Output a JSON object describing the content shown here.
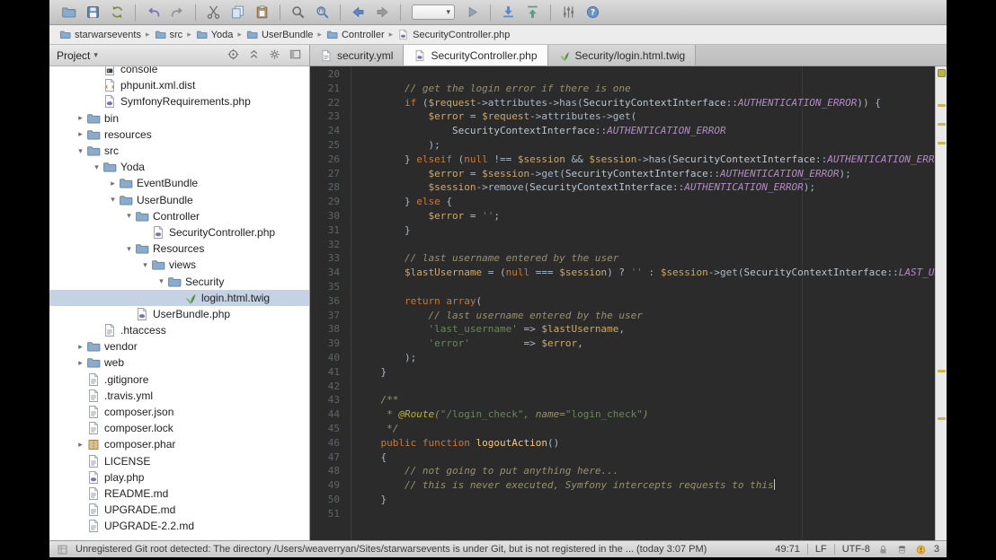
{
  "colors": {
    "editor_bg": "#2b2b2b",
    "keyword": "#cc7832",
    "string": "#6a8759",
    "comment": "#98916b",
    "constant": "#b38cc4",
    "variable": "#cda869",
    "selection": "#c4d2e3",
    "error_stripe_mark": "#c9b944"
  },
  "toolbar": {
    "groups": [
      [
        "open-folder",
        "save-all",
        "synchronize"
      ],
      [
        "undo",
        "redo"
      ],
      [
        "cut",
        "copy",
        "paste"
      ],
      [
        "find",
        "replace"
      ],
      [
        "back",
        "forward"
      ],
      [
        "run-config",
        "run"
      ],
      [
        "update-project",
        "commit"
      ],
      [
        "settings",
        "help"
      ]
    ]
  },
  "breadcrumbs": {
    "items": [
      {
        "label": "starwarsevents",
        "icon": "folder"
      },
      {
        "label": "src",
        "icon": "folder"
      },
      {
        "label": "Yoda",
        "icon": "folder"
      },
      {
        "label": "UserBundle",
        "icon": "folder"
      },
      {
        "label": "Controller",
        "icon": "folder"
      },
      {
        "label": "SecurityController.php",
        "icon": "php"
      }
    ]
  },
  "project_pane": {
    "title": "Project",
    "icons": [
      "locate",
      "collapse-all",
      "gear",
      "hide"
    ]
  },
  "tree": {
    "items": [
      {
        "label": "console",
        "level": 2,
        "icon": "console",
        "arrow": null
      },
      {
        "label": "phpunit.xml.dist",
        "level": 2,
        "icon": "xml",
        "arrow": null
      },
      {
        "label": "SymfonyRequirements.php",
        "level": 2,
        "icon": "php",
        "arrow": null
      },
      {
        "label": "bin",
        "level": 1,
        "icon": "folder",
        "arrow": "collapsed"
      },
      {
        "label": "resources",
        "level": 1,
        "icon": "folder",
        "arrow": "collapsed"
      },
      {
        "label": "src",
        "level": 1,
        "icon": "folder",
        "arrow": "expanded"
      },
      {
        "label": "Yoda",
        "level": 2,
        "icon": "folder",
        "arrow": "expanded"
      },
      {
        "label": "EventBundle",
        "level": 3,
        "icon": "folder",
        "arrow": "collapsed"
      },
      {
        "label": "UserBundle",
        "level": 3,
        "icon": "folder",
        "arrow": "expanded"
      },
      {
        "label": "Controller",
        "level": 4,
        "icon": "folder",
        "arrow": "expanded"
      },
      {
        "label": "SecurityController.php",
        "level": 5,
        "icon": "php",
        "arrow": null
      },
      {
        "label": "Resources",
        "level": 4,
        "icon": "folder",
        "arrow": "expanded"
      },
      {
        "label": "views",
        "level": 5,
        "icon": "folder",
        "arrow": "expanded"
      },
      {
        "label": "Security",
        "level": 6,
        "icon": "folder",
        "arrow": "expanded"
      },
      {
        "label": "login.html.twig",
        "level": 7,
        "icon": "twig",
        "arrow": null,
        "selected": true
      },
      {
        "label": "UserBundle.php",
        "level": 4,
        "icon": "php",
        "arrow": null
      },
      {
        "label": ".htaccess",
        "level": 2,
        "icon": "text",
        "arrow": null
      },
      {
        "label": "vendor",
        "level": 1,
        "icon": "folder",
        "arrow": "collapsed"
      },
      {
        "label": "web",
        "level": 1,
        "icon": "folder",
        "arrow": "collapsed"
      },
      {
        "label": ".gitignore",
        "level": 1,
        "icon": "text",
        "arrow": null
      },
      {
        "label": ".travis.yml",
        "level": 1,
        "icon": "text",
        "arrow": null
      },
      {
        "label": "composer.json",
        "level": 1,
        "icon": "text",
        "arrow": null
      },
      {
        "label": "composer.lock",
        "level": 1,
        "icon": "text",
        "arrow": null
      },
      {
        "label": "composer.phar",
        "level": 1,
        "icon": "archive",
        "arrow": "collapsed"
      },
      {
        "label": "LICENSE",
        "level": 1,
        "icon": "text",
        "arrow": null
      },
      {
        "label": "play.php",
        "level": 1,
        "icon": "php",
        "arrow": null
      },
      {
        "label": "README.md",
        "level": 1,
        "icon": "text",
        "arrow": null
      },
      {
        "label": "UPGRADE.md",
        "level": 1,
        "icon": "text",
        "arrow": null
      },
      {
        "label": "UPGRADE-2.2.md",
        "level": 1,
        "icon": "text",
        "arrow": null
      }
    ]
  },
  "tabs": {
    "items": [
      {
        "label": "security.yml",
        "icon": "yml",
        "active": false
      },
      {
        "label": "SecurityController.php",
        "icon": "php",
        "active": true
      },
      {
        "label": "Security/login.html.twig",
        "icon": "twig",
        "active": false
      }
    ]
  },
  "editor": {
    "caret": {
      "line": 49,
      "col": 71
    },
    "stripe_marks_percent": [
      8,
      12,
      16,
      64,
      74
    ],
    "lines": [
      {
        "n": 20,
        "t": []
      },
      {
        "n": 21,
        "t": [
          [
            "pl",
            "        "
          ],
          [
            "cmt",
            "// get the login error if there is one"
          ]
        ]
      },
      {
        "n": 22,
        "t": [
          [
            "pl",
            "        "
          ],
          [
            "kw",
            "if"
          ],
          [
            "pl",
            " ("
          ],
          [
            "var",
            "$request"
          ],
          [
            "pl",
            "->attributes->has("
          ],
          [
            "cls",
            "SecurityContextInterface"
          ],
          [
            "pl",
            "::"
          ],
          [
            "const",
            "AUTHENTICATION_ERROR"
          ],
          [
            "pl",
            ")) {"
          ]
        ]
      },
      {
        "n": 23,
        "t": [
          [
            "pl",
            "            "
          ],
          [
            "var",
            "$error"
          ],
          [
            "pl",
            " = "
          ],
          [
            "var",
            "$request"
          ],
          [
            "pl",
            "->attributes->get("
          ]
        ]
      },
      {
        "n": 24,
        "t": [
          [
            "pl",
            "                "
          ],
          [
            "cls",
            "SecurityContextInterface"
          ],
          [
            "pl",
            "::"
          ],
          [
            "const",
            "AUTHENTICATION_ERROR"
          ]
        ]
      },
      {
        "n": 25,
        "t": [
          [
            "pl",
            "            );"
          ]
        ]
      },
      {
        "n": 26,
        "t": [
          [
            "pl",
            "        } "
          ],
          [
            "kw",
            "elseif"
          ],
          [
            "pl",
            " ("
          ],
          [
            "kw",
            "null"
          ],
          [
            "pl",
            " !== "
          ],
          [
            "var",
            "$session"
          ],
          [
            "pl",
            " && "
          ],
          [
            "var",
            "$session"
          ],
          [
            "pl",
            "->has("
          ],
          [
            "cls",
            "SecurityContextInterface"
          ],
          [
            "pl",
            "::"
          ],
          [
            "const",
            "AUTHENTICATION_ERROR"
          ],
          [
            "pl",
            ")) {"
          ]
        ]
      },
      {
        "n": 27,
        "t": [
          [
            "pl",
            "            "
          ],
          [
            "var",
            "$error"
          ],
          [
            "pl",
            " = "
          ],
          [
            "var",
            "$session"
          ],
          [
            "pl",
            "->get("
          ],
          [
            "cls",
            "SecurityContextInterface"
          ],
          [
            "pl",
            "::"
          ],
          [
            "const",
            "AUTHENTICATION_ERROR"
          ],
          [
            "pl",
            ");"
          ]
        ]
      },
      {
        "n": 28,
        "t": [
          [
            "pl",
            "            "
          ],
          [
            "var",
            "$session"
          ],
          [
            "pl",
            "->remove("
          ],
          [
            "cls",
            "SecurityContextInterface"
          ],
          [
            "pl",
            "::"
          ],
          [
            "const",
            "AUTHENTICATION_ERROR"
          ],
          [
            "pl",
            ");"
          ]
        ]
      },
      {
        "n": 29,
        "t": [
          [
            "pl",
            "        } "
          ],
          [
            "kw",
            "else"
          ],
          [
            "pl",
            " {"
          ]
        ]
      },
      {
        "n": 30,
        "t": [
          [
            "pl",
            "            "
          ],
          [
            "var",
            "$error"
          ],
          [
            "pl",
            " = "
          ],
          [
            "str",
            "''"
          ],
          [
            "pl",
            ";"
          ]
        ]
      },
      {
        "n": 31,
        "t": [
          [
            "pl",
            "        }"
          ]
        ]
      },
      {
        "n": 32,
        "t": []
      },
      {
        "n": 33,
        "t": [
          [
            "pl",
            "        "
          ],
          [
            "cmt",
            "// last username entered by the user"
          ]
        ]
      },
      {
        "n": 34,
        "t": [
          [
            "pl",
            "        "
          ],
          [
            "var",
            "$lastUsername"
          ],
          [
            "pl",
            " = ("
          ],
          [
            "kw",
            "null"
          ],
          [
            "pl",
            " === "
          ],
          [
            "var",
            "$session"
          ],
          [
            "pl",
            ") ? "
          ],
          [
            "str",
            "''"
          ],
          [
            "pl",
            " : "
          ],
          [
            "var",
            "$session"
          ],
          [
            "pl",
            "->get("
          ],
          [
            "cls",
            "SecurityContextInterface"
          ],
          [
            "pl",
            "::"
          ],
          [
            "const",
            "LAST_USERNAME"
          ],
          [
            "pl",
            ");"
          ]
        ]
      },
      {
        "n": 35,
        "t": []
      },
      {
        "n": 36,
        "t": [
          [
            "pl",
            "        "
          ],
          [
            "kw",
            "return"
          ],
          [
            "pl",
            " "
          ],
          [
            "kw",
            "array"
          ],
          [
            "pl",
            "("
          ]
        ]
      },
      {
        "n": 37,
        "t": [
          [
            "pl",
            "            "
          ],
          [
            "cmt",
            "// last username entered by the user"
          ]
        ]
      },
      {
        "n": 38,
        "t": [
          [
            "pl",
            "            "
          ],
          [
            "str",
            "'last_username'"
          ],
          [
            "pl",
            " => "
          ],
          [
            "var",
            "$lastUsername"
          ],
          [
            "pl",
            ","
          ]
        ]
      },
      {
        "n": 39,
        "t": [
          [
            "pl",
            "            "
          ],
          [
            "str",
            "'error'"
          ],
          [
            "pl",
            "         => "
          ],
          [
            "var",
            "$error"
          ],
          [
            "pl",
            ","
          ]
        ]
      },
      {
        "n": 40,
        "t": [
          [
            "pl",
            "        );"
          ]
        ]
      },
      {
        "n": 41,
        "t": [
          [
            "pl",
            "    }"
          ]
        ]
      },
      {
        "n": 42,
        "t": []
      },
      {
        "n": 43,
        "t": [
          [
            "pl",
            "    "
          ],
          [
            "doc",
            "/**"
          ]
        ]
      },
      {
        "n": 44,
        "t": [
          [
            "pl",
            "     "
          ],
          [
            "doc",
            "* "
          ],
          [
            "ann",
            "@Route"
          ],
          [
            "doc",
            "("
          ],
          [
            "str",
            "\"/login_check\""
          ],
          [
            "doc",
            ", name="
          ],
          [
            "str",
            "\"login_check\""
          ],
          [
            "doc",
            ")"
          ]
        ]
      },
      {
        "n": 45,
        "t": [
          [
            "pl",
            "     "
          ],
          [
            "doc",
            "*/"
          ]
        ]
      },
      {
        "n": 46,
        "t": [
          [
            "pl",
            "    "
          ],
          [
            "kw",
            "public function"
          ],
          [
            "pl",
            " "
          ],
          [
            "fn",
            "logoutAction"
          ],
          [
            "pl",
            "()"
          ]
        ]
      },
      {
        "n": 47,
        "t": [
          [
            "pl",
            "    {"
          ]
        ]
      },
      {
        "n": 48,
        "t": [
          [
            "pl",
            "        "
          ],
          [
            "cmt",
            "// not going to put anything here..."
          ]
        ]
      },
      {
        "n": 49,
        "t": [
          [
            "pl",
            "        "
          ],
          [
            "cmt",
            "// this is never executed, Symfony intercepts requests to this"
          ]
        ]
      },
      {
        "n": 50,
        "t": [
          [
            "pl",
            "    }"
          ]
        ]
      },
      {
        "n": 51,
        "t": []
      }
    ]
  },
  "statusbar": {
    "message": "Unregistered Git root detected: The directory /Users/weaverryan/Sites/starwarsevents is under Git, but is not registered in the ... (today 3:07 PM)",
    "position": "49:71",
    "line_separator": "LF",
    "encoding": "UTF-8",
    "notification_count": "3"
  }
}
